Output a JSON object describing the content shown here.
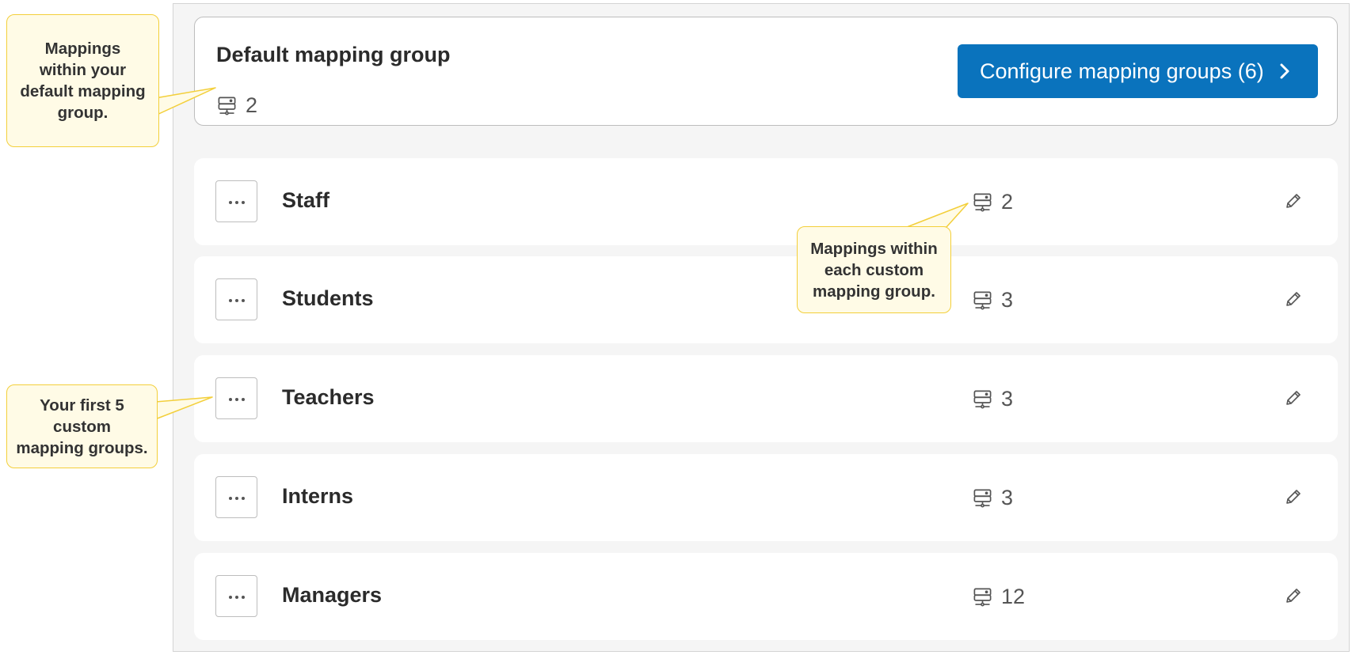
{
  "default_group": {
    "title": "Default mapping group",
    "mapping_count": "2",
    "icon": "server-mapping-icon"
  },
  "configure_button": {
    "label": "Configure mapping groups (6)",
    "icon": "chevron-right-icon",
    "color": "#0a73bd"
  },
  "groups": [
    {
      "name": "Staff",
      "mapping_count": "2"
    },
    {
      "name": "Students",
      "mapping_count": "3"
    },
    {
      "name": "Teachers",
      "mapping_count": "3"
    },
    {
      "name": "Interns",
      "mapping_count": "3"
    },
    {
      "name": "Managers",
      "mapping_count": "12"
    }
  ],
  "row_icons": {
    "more": "more-dots-icon",
    "edit": "pencil-icon",
    "mapping": "server-mapping-icon"
  },
  "callouts": {
    "default_mappings": [
      "Mappings",
      "within your",
      "default mapping",
      "group."
    ],
    "custom_mappings": [
      "Mappings within",
      "each custom",
      "mapping group."
    ],
    "first_five": [
      "Your first 5",
      "custom",
      "mapping groups."
    ]
  },
  "colors": {
    "accent": "#0a73bd",
    "callout_bg": "#fffbe6",
    "callout_border": "#f3cf3a"
  }
}
